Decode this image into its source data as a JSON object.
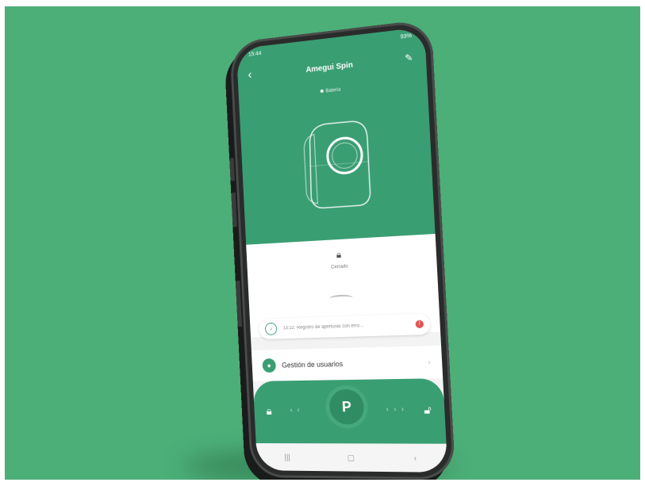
{
  "statusbar": {
    "time": "15:44",
    "indicators": "✉ ✉",
    "battery": "93%"
  },
  "header": {
    "title": "Amegui Spin",
    "back_icon": "back-arrow-icon",
    "edit_icon": "edit-pencil-icon"
  },
  "device": {
    "battery_text": "Batería"
  },
  "lock_status": {
    "label": "Cerrado"
  },
  "notification": {
    "text": "13:22: Registro de aperturas con erro...",
    "badge": "!"
  },
  "users": {
    "label": "Gestión de usuarios"
  },
  "control": {
    "key_glyph": "P",
    "left_arrows": "‹ ‹",
    "right_arrows": "› › ›"
  },
  "colors": {
    "background": "#4caf78",
    "accent": "#3a9e73",
    "alert": "#e05555"
  }
}
